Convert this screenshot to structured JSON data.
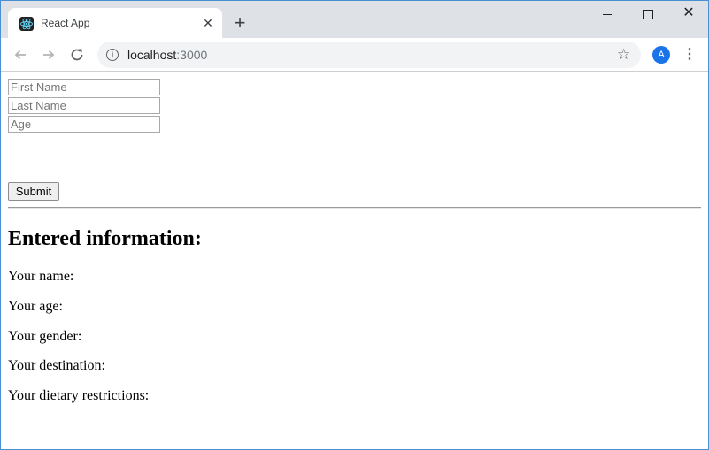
{
  "browser": {
    "tab_title": "React App",
    "tab_close": "✕",
    "new_tab": "+",
    "url_host": "localhost",
    "url_port": ":3000",
    "icons": [
      "react-favicon",
      "back-arrow-icon",
      "forward-arrow-icon",
      "reload-icon",
      "info-icon",
      "star-icon",
      "kebab-menu-icon",
      "minimize-icon",
      "maximize-icon",
      "close-icon"
    ],
    "profile_initial": "A",
    "profile_color": "#1a73e8",
    "window_border_color": "#4a8fd4"
  },
  "form": {
    "first_name_placeholder": "First Name",
    "last_name_placeholder": "Last Name",
    "age_placeholder": "Age",
    "submit_label": "Submit"
  },
  "results": {
    "heading": "Entered information:",
    "name_label": "Your name:",
    "age_label": "Your age:",
    "gender_label": "Your gender:",
    "destination_label": "Your destination:",
    "dietary_label": "Your dietary restrictions:"
  }
}
